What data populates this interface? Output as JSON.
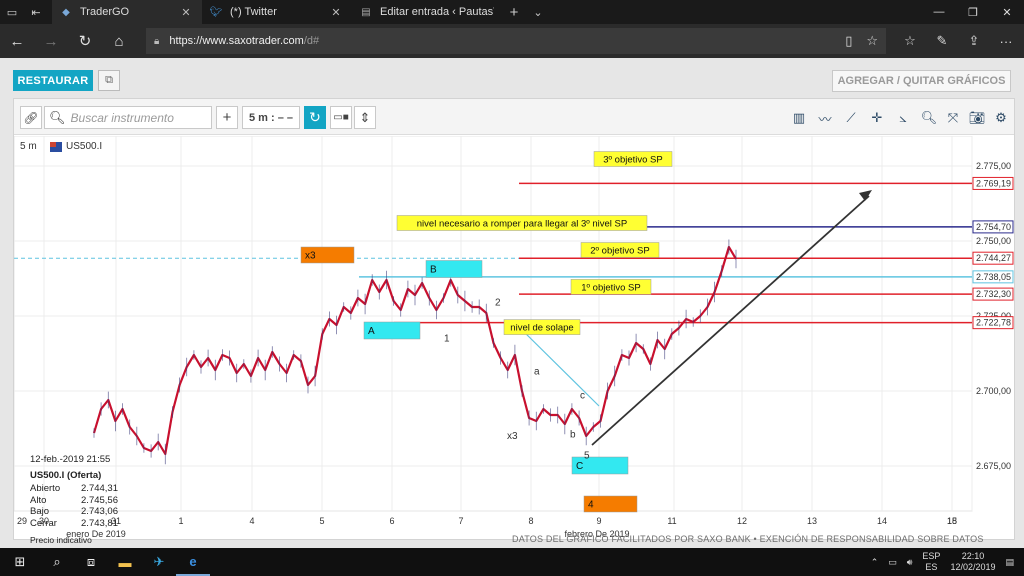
{
  "browser": {
    "tabs": [
      {
        "title": "TraderGO",
        "icon": "saxo-icon",
        "active": true
      },
      {
        "title": "(*) Twitter",
        "icon": "twitter-icon",
        "active": false
      },
      {
        "title": "Editar entrada ‹ PautasTerm",
        "icon": "page-icon",
        "active": false
      }
    ],
    "url_host": "https://www.saxotrader.com",
    "url_path": "/d#"
  },
  "page": {
    "restore_label": "RESTAURAR",
    "add_remove_label": "AGREGAR / QUITAR GRÁFICOS",
    "search_placeholder": "Buscar instrumento",
    "timeframe_label": "5 m : – –"
  },
  "chart_header": {
    "interval": "5 m",
    "instrument": "US500.I"
  },
  "info_panel": {
    "datetime": "12-feb.-2019 21:55",
    "name": "US500.I (Oferta)",
    "rows": [
      {
        "label": "Abierto",
        "value": "2.744,31"
      },
      {
        "label": "Alto",
        "value": "2.745,56"
      },
      {
        "label": "Bajo",
        "value": "2.743,06"
      },
      {
        "label": "Cerrar",
        "value": "2.743,81"
      }
    ],
    "footer": "Precio indicativo"
  },
  "chart_data": {
    "type": "line",
    "title": "",
    "ylim": [
      2660,
      2785
    ],
    "y_ticks": [
      {
        "value": 2775,
        "label": "2.775,00"
      },
      {
        "value": 2750,
        "label": "2.750,00"
      },
      {
        "value": 2725,
        "label": "2.725,00"
      },
      {
        "value": 2700,
        "label": "2.700,00"
      },
      {
        "value": 2675,
        "label": "2.675,00"
      }
    ],
    "x_ticks": [
      "29",
      "30",
      "31",
      "1",
      "4",
      "5",
      "6",
      "7",
      "8",
      "9",
      "11",
      "12",
      "13",
      "14",
      "15",
      "18"
    ],
    "x_group_labels": [
      "enero De 2019",
      "febrero De 2019"
    ],
    "series": [
      {
        "values": [
          2686,
          2694,
          2697,
          2690,
          2694,
          2688,
          2685,
          2681,
          2680,
          2683,
          2679,
          2693,
          2702,
          2708,
          2712,
          2708,
          2711,
          2707,
          2712,
          2711,
          2706,
          2709,
          2705,
          2711,
          2707,
          2713,
          2709,
          2706,
          2712,
          2710,
          2702,
          2705,
          2719,
          2724,
          2722,
          2728,
          2726,
          2731,
          2729,
          2737,
          2733,
          2737,
          2730,
          2727,
          2734,
          2732,
          2736,
          2731,
          2727,
          2731,
          2737,
          2732,
          2730,
          2728,
          2728,
          2726,
          2716,
          2711,
          2707,
          2712,
          2700,
          2691,
          2690,
          2694,
          2692,
          2692,
          2689,
          2694,
          2691,
          2685,
          2688,
          2690,
          2700,
          2705,
          2712,
          2711,
          2716,
          2714,
          2709,
          2717,
          2714,
          2719,
          2721,
          2724,
          2723,
          2725,
          2728,
          2733,
          2740,
          2748,
          2744
        ]
      }
    ],
    "price_labels": [
      {
        "value": 2769.19,
        "label": "2.769,19",
        "color": "red"
      },
      {
        "value": 2754.7,
        "label": "2.754,70",
        "color": "navy"
      },
      {
        "value": 2744.27,
        "label": "2.744,27",
        "color": "red"
      },
      {
        "value": 2738.05,
        "label": "2.738,05",
        "color": "lightblue"
      },
      {
        "value": 2732.3,
        "label": "2.732,30",
        "color": "red"
      },
      {
        "value": 2722.78,
        "label": "2.722,78",
        "color": "red"
      }
    ],
    "annotations": [
      {
        "text": "3º objetivo SP",
        "style": "yellow"
      },
      {
        "text": "nivel necesario a romper  para llegar al 3º nivel SP",
        "style": "yellow"
      },
      {
        "text": "2º objetivo SP",
        "style": "yellow"
      },
      {
        "text": "1º  objetivo SP",
        "style": "yellow"
      },
      {
        "text": "nivel de solape",
        "style": "yellow"
      },
      {
        "text": "x3",
        "style": "orange"
      },
      {
        "text": "4",
        "style": "orange"
      },
      {
        "text": "B",
        "style": "cyan"
      },
      {
        "text": "A",
        "style": "cyan"
      },
      {
        "text": "C",
        "style": "cyan"
      }
    ],
    "wave_labels": [
      "1",
      "2",
      "a",
      "b",
      "c",
      "x3",
      "5"
    ],
    "colors": {
      "candles": "#c8102e",
      "resistance": "#e0202a",
      "key_level": "#2a2a8c",
      "support": "#5fc4e0"
    }
  },
  "watermark": "DATOS DEL GRÁFICO FACILITADOS POR SAXO BANK • EXENCIÓN DE RESPONSABILIDAD SOBRE DATOS",
  "taskbar": {
    "lang_top": "ESP",
    "lang_bottom": "ES",
    "time": "22:10",
    "date": "12/02/2019"
  }
}
